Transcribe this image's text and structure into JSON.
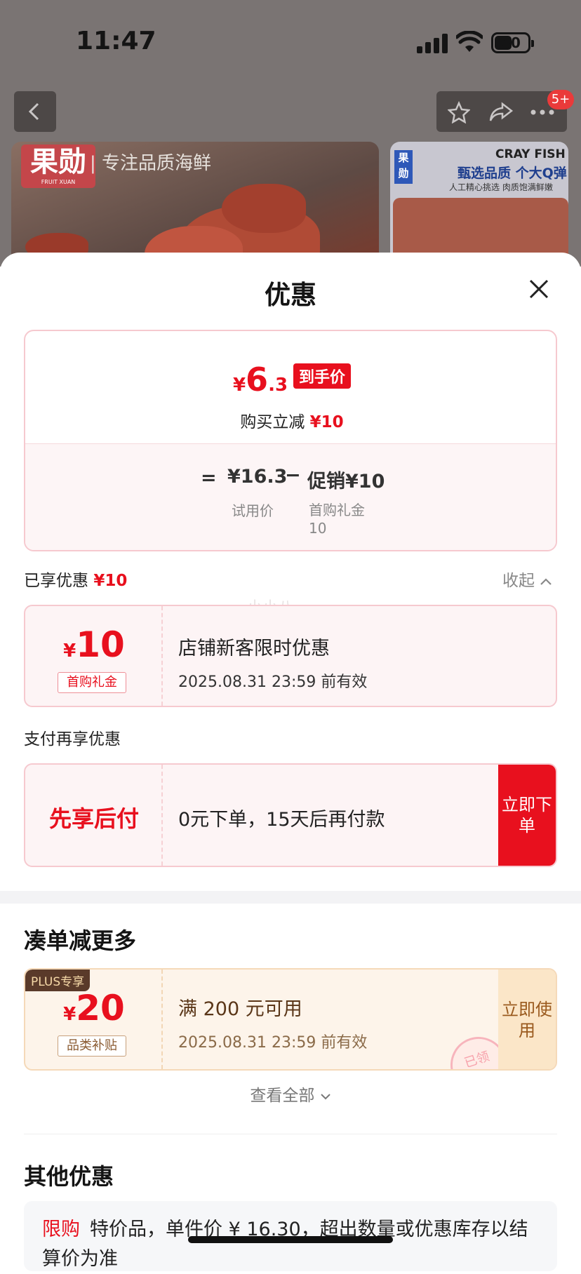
{
  "status_bar": {
    "time": "11:47",
    "battery": "50"
  },
  "header": {
    "cart_badge": "5+"
  },
  "banners": {
    "left_logo": "果勋",
    "left_logo_sub": "FRUIT XUAN",
    "left_tagline": "| 专注品质海鲜",
    "right_logo": "果勋",
    "right_brand": "CRAY FISH",
    "right_title": "甄选品质 个大Q弹",
    "right_sub": "人工精心挑选 肉质饱满鲜嫩"
  },
  "sheet": {
    "title": "优惠",
    "summary": {
      "yen": "¥",
      "final_int": "6",
      "final_dec": ".3",
      "final_tag": "到手价",
      "discount_text": "购买立减",
      "discount_amount": "¥10",
      "equals": "=",
      "trial_price": "¥16.3",
      "minus": "−",
      "promo": "促销¥10",
      "trial_label": "试用价",
      "promo_label": "首购礼金 10"
    },
    "enjoyed": {
      "label": "已享优惠",
      "amount": "¥10",
      "collapse": "收起"
    },
    "watermark": "小小八",
    "coupon_store": {
      "yen": "¥",
      "amount": "10",
      "tag": "首购礼金",
      "title": "店铺新客限时优惠",
      "validity": "2025.08.31 23:59 前有效"
    },
    "pay_section": {
      "label": "支付再享优惠"
    },
    "coupon_pay": {
      "title": "先享后付",
      "desc": "0元下单，15天后再付款",
      "button": "立即下单"
    },
    "more": {
      "heading": "凑单减更多",
      "plus_tag": "PLUS专享",
      "yen": "¥",
      "amount": "20",
      "tag": "品类补贴",
      "condition": "满 200 元可用",
      "validity": "2025.08.31 23:59 前有效",
      "button": "立即使用",
      "stamp": "已领",
      "view_all": "查看全部"
    },
    "other": {
      "heading": "其他优惠",
      "limit_tag": "限购",
      "text": "特价品，单件价 ¥ 16.30，超出数量或优惠库存以结算价为准"
    }
  }
}
